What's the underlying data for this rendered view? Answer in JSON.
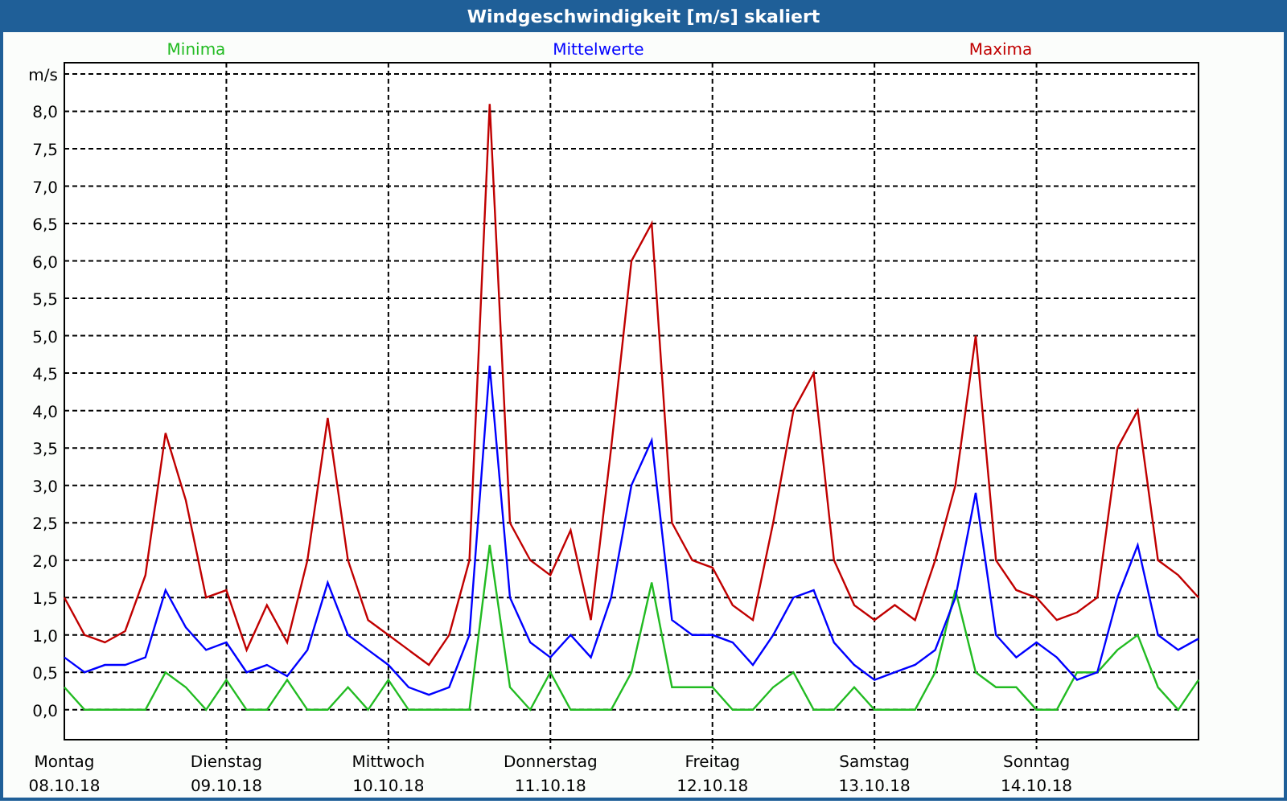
{
  "window": {
    "title": "Windgeschwindigkeit [m/s] skaliert"
  },
  "chart": {
    "chart_data": {
      "type": "line",
      "grid": true,
      "ylabel": "m/s",
      "ylim": [
        -0.4,
        8.65
      ],
      "categories": [
        "Montag",
        null,
        null,
        null,
        null,
        null,
        null,
        null,
        "Dienstag",
        null,
        null,
        null,
        null,
        null,
        null,
        null,
        "Mittwoch",
        null,
        null,
        null,
        null,
        null,
        null,
        null,
        "Donnerstag",
        null,
        null,
        null,
        null,
        null,
        null,
        null,
        "Freitag",
        null,
        null,
        null,
        null,
        null,
        null,
        null,
        "Samstag",
        null,
        null,
        null,
        null,
        null,
        null,
        null,
        "Sonntag",
        null,
        null,
        null,
        null,
        null,
        null,
        null,
        null
      ],
      "yticks": [
        {
          "value": 0,
          "label": "0,0"
        },
        {
          "value": 0.5,
          "label": "0,5"
        },
        {
          "value": 1,
          "label": "1,0"
        },
        {
          "value": 1.5,
          "label": "1,5"
        },
        {
          "value": 2,
          "label": "2,0"
        },
        {
          "value": 2.5,
          "label": "2,5"
        },
        {
          "value": 3,
          "label": "3,0"
        },
        {
          "value": 3.5,
          "label": "3,5"
        },
        {
          "value": 4,
          "label": "4,0"
        },
        {
          "value": 4.5,
          "label": "4,5"
        },
        {
          "value": 5,
          "label": "5,0"
        },
        {
          "value": 5.5,
          "label": "5,5"
        },
        {
          "value": 6,
          "label": "6,0"
        },
        {
          "value": 6.5,
          "label": "6,5"
        },
        {
          "value": 7,
          "label": "7,0"
        },
        {
          "value": 7.5,
          "label": "7,5"
        },
        {
          "value": 8,
          "label": "8,0"
        }
      ],
      "series": [
        {
          "name": "Minima",
          "color": "#22bb22",
          "values": [
            0.3,
            0,
            0,
            0,
            0,
            0.5,
            0.3,
            0,
            0.4,
            0,
            0,
            0.4,
            0,
            0,
            0.3,
            0,
            0.4,
            0,
            0,
            0,
            0,
            2.2,
            0.3,
            0,
            0.5,
            0,
            0,
            0,
            0.5,
            1.7,
            0.3,
            0.3,
            0.3,
            0,
            0,
            0.3,
            0.5,
            0,
            0,
            0.3,
            0,
            0,
            0,
            0.5,
            1.6,
            0.5,
            0.3,
            0.3,
            0,
            0,
            0.5,
            0.5,
            0.8,
            1,
            0.3,
            0,
            0.4
          ]
        },
        {
          "name": "Mittelwerte",
          "color": "#0000ff",
          "values": [
            0.7,
            0.5,
            0.6,
            0.6,
            0.7,
            1.6,
            1.1,
            0.8,
            0.9,
            0.5,
            0.6,
            0.45,
            0.8,
            1.7,
            1,
            0.8,
            0.6,
            0.3,
            0.2,
            0.3,
            1,
            4.6,
            1.5,
            0.9,
            0.7,
            1,
            0.7,
            1.5,
            3,
            3.6,
            1.2,
            1,
            1,
            0.9,
            0.6,
            1,
            1.5,
            1.6,
            0.9,
            0.6,
            0.4,
            0.5,
            0.6,
            0.8,
            1.5,
            2.9,
            1,
            0.7,
            0.9,
            0.7,
            0.4,
            0.5,
            1.5,
            2.2,
            1,
            0.8,
            0.95
          ]
        },
        {
          "name": "Maxima",
          "color": "#c00000",
          "values": [
            1.5,
            1,
            0.9,
            1.05,
            1.8,
            3.7,
            2.8,
            1.5,
            1.6,
            0.8,
            1.4,
            0.9,
            2,
            3.9,
            2,
            1.2,
            1,
            0.8,
            0.6,
            1,
            2,
            8.1,
            2.5,
            2,
            1.8,
            2.4,
            1.2,
            3.5,
            6,
            6.5,
            2.5,
            2,
            1.9,
            1.4,
            1.2,
            2.5,
            4,
            4.5,
            2,
            1.4,
            1.2,
            1.4,
            1.2,
            2,
            3,
            5,
            2,
            1.6,
            1.5,
            1.2,
            1.3,
            1.5,
            3.5,
            4,
            2,
            1.8,
            1.5
          ]
        }
      ]
    },
    "dates": [
      "08.10.18",
      "09.10.18",
      "10.10.18",
      "11.10.18",
      "12.10.18",
      "13.10.18",
      "14.10.18"
    ]
  }
}
